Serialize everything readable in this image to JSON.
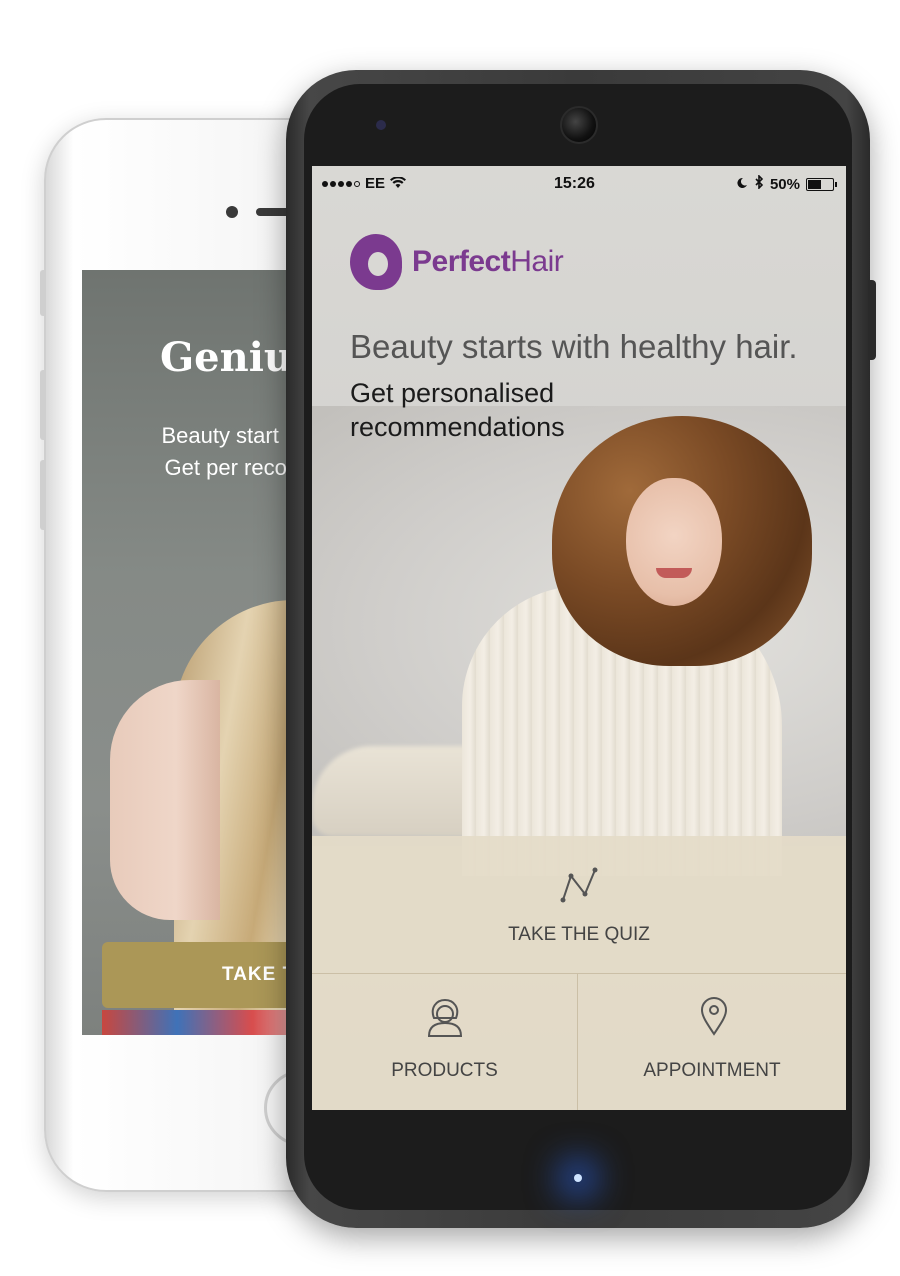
{
  "back_phone": {
    "headline": "Geniu",
    "subtext": "Beauty start hair. Get per recomm",
    "cta_label": "TAKE T",
    "cta_color": "#ab9757"
  },
  "front_phone": {
    "status_bar": {
      "carrier": "EE",
      "time": "15:26",
      "battery": "50%",
      "battery_level": 0.5,
      "icons": [
        "signal-icon",
        "wifi-icon",
        "moon-icon",
        "bluetooth-icon",
        "battery-icon"
      ]
    },
    "brand": {
      "name_bold": "Perfect",
      "name_light": "Hair",
      "color": "#7b3a8f",
      "icon": "logo-icon"
    },
    "headline": "Beauty starts with healthy hair.",
    "subheadline": "Get personalised recommendations",
    "actions": {
      "quiz": {
        "label": "TAKE THE QUIZ",
        "icon": "quiz-icon"
      },
      "products": {
        "label": "PRODUCTS",
        "icon": "person-icon"
      },
      "appointment": {
        "label": "APPOINTMENT",
        "icon": "location-pin-icon"
      }
    }
  }
}
